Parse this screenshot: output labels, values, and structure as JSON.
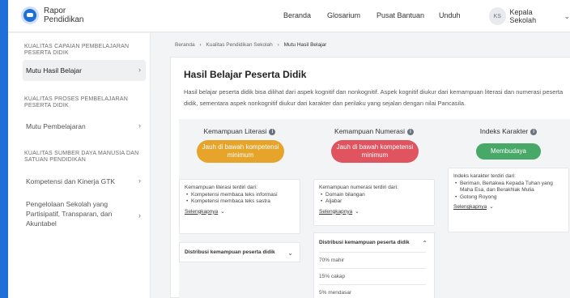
{
  "brand": {
    "line1": "Rapor",
    "line2": "Pendidikan"
  },
  "nav": {
    "items": [
      "Beranda",
      "Glosarium",
      "Pusat Bantuan",
      "Unduh"
    ]
  },
  "user": {
    "initials": "KS",
    "name": "Kepala Sekolah"
  },
  "sidebar": {
    "sections": [
      {
        "title": "KUALITAS CAPAIAN PEMBELAJARAN PESERTA DIDIK",
        "items": [
          {
            "label": "Mutu Hasil Belajar"
          }
        ]
      },
      {
        "title": "KUALITAS PROSES PEMBELAJARAN PESERTA DIDIK",
        "items": [
          {
            "label": "Mutu Pembelajaran"
          }
        ]
      },
      {
        "title": "KUALITAS SUMBER DAYA MANUSIA DAN SATUAN PENDIDIKAN",
        "items": [
          {
            "label": "Kompetensi dan Kinerja GTK"
          },
          {
            "label": "Pengelolaan Sekolah yang Partisipatif, Transparan, dan Akuntabel"
          }
        ]
      }
    ]
  },
  "breadcrumb": {
    "items": [
      "Beranda",
      "Kualitas Pendidikan Sekolah",
      "Mutu Hasil Belajar"
    ]
  },
  "main": {
    "title": "Hasil Belajar Peserta Didik",
    "description": "Hasil belajar peserta didik bisa dilihat dari aspek kognitif dan nonkognitif. Aspek kognitif diukur dari kemampuan literasi dan numerasi peserta didik, sementara aspek nonkognitif diukur dari karakter dan perilaku yang sejalan dengan nilai Pancasila."
  },
  "columns": [
    {
      "title": "Kemampuan Literasi",
      "status": "Jauh di bawah kompetensi minimum",
      "status_color": "#e6a42a",
      "info_intro": "Kemampuan literasi terdiri dari:",
      "bullets": [
        "Kompetensi membaca teks informasi",
        "Kompetensi membaca teks sastra"
      ],
      "more": "Selengkapnya",
      "dist_title": "Distribusi kemampuan peserta didik"
    },
    {
      "title": "Kemampuan Numerasi",
      "status": "Jauh di bawah kompetensi minimum",
      "status_color": "#e0545f",
      "info_intro": "Kemampuan numerasi terdiri dari:",
      "bullets": [
        "Domain bilangan",
        "Aljabar"
      ],
      "more": "Selengkapnya",
      "dist_title": "Distribusi kemampuan peserta didik",
      "dist_rows": [
        "70% mahir",
        "15% cakap",
        "5% mendasar"
      ]
    },
    {
      "title": "Indeks Karakter",
      "status": "Membudaya",
      "status_color": "#47a867",
      "info_intro": "Indeks karakter terdiri dari:",
      "bullets": [
        "Beriman, Bertakwa Kepada Tuhan yang Maha Esa, dan Berakhlak Mulia",
        "Gotong Royong"
      ],
      "more": "Selengkapnya"
    }
  ],
  "icons": {
    "info": "i",
    "chevron_right": "›",
    "chevron_down": "⌄",
    "chevron_up": "⌃",
    "breadcrumb_sep": "›"
  }
}
